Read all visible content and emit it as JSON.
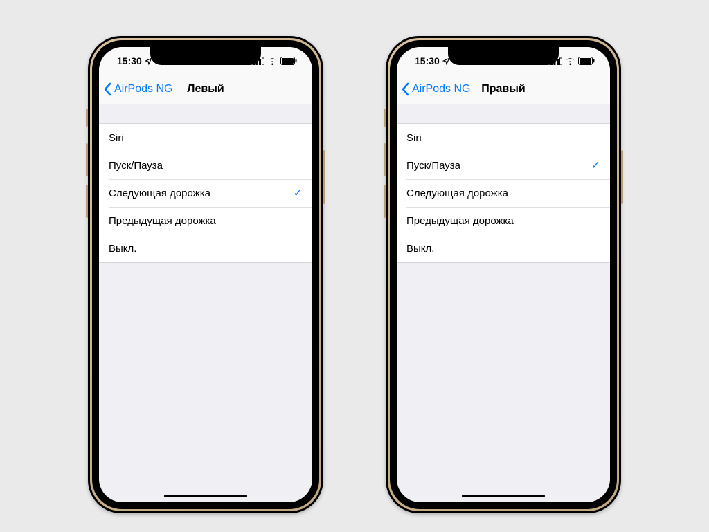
{
  "status": {
    "time": "15:30"
  },
  "phones": [
    {
      "back_label": "AirPods NG",
      "title": "Левый",
      "options": [
        {
          "label": "Siri",
          "selected": false
        },
        {
          "label": "Пуск/Пауза",
          "selected": false
        },
        {
          "label": "Следующая дорожка",
          "selected": true
        },
        {
          "label": "Предыдущая дорожка",
          "selected": false
        },
        {
          "label": "Выкл.",
          "selected": false
        }
      ]
    },
    {
      "back_label": "AirPods NG",
      "title": "Правый",
      "options": [
        {
          "label": "Siri",
          "selected": false
        },
        {
          "label": "Пуск/Пауза",
          "selected": true
        },
        {
          "label": "Следующая дорожка",
          "selected": false
        },
        {
          "label": "Предыдущая дорожка",
          "selected": false
        },
        {
          "label": "Выкл.",
          "selected": false
        }
      ]
    }
  ]
}
